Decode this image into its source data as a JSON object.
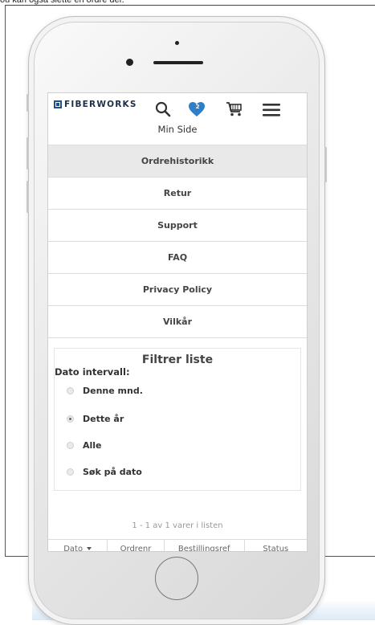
{
  "caption": "ou kan også slette en ordre der.",
  "header": {
    "brand": "FIBERWORKS",
    "wishlist_count": "2",
    "title": "Min Side"
  },
  "menu": {
    "items": [
      "Ordrehistorikk",
      "Retur",
      "Support",
      "FAQ",
      "Privacy Policy",
      "Vilkår"
    ],
    "active": "Ordrehistorikk"
  },
  "filter": {
    "title": "Filtrer liste",
    "label": "Dato intervall:",
    "options": [
      "Denne mnd.",
      "Dette år",
      "Alle",
      "Søk på dato"
    ],
    "selected": "Dette år"
  },
  "results": {
    "count_text": "1 - 1 av 1 varer i listen"
  },
  "table": {
    "columns": [
      "Dato",
      "Ordrenr",
      "Bestillingsref",
      "Status"
    ]
  },
  "colors": {
    "brand": "#1f4f8b",
    "heart": "#2f7ec8",
    "active_bg": "#e9e9e9"
  },
  "icons": [
    "search-icon",
    "heart-icon",
    "cart-icon",
    "hamburger-menu-icon"
  ]
}
